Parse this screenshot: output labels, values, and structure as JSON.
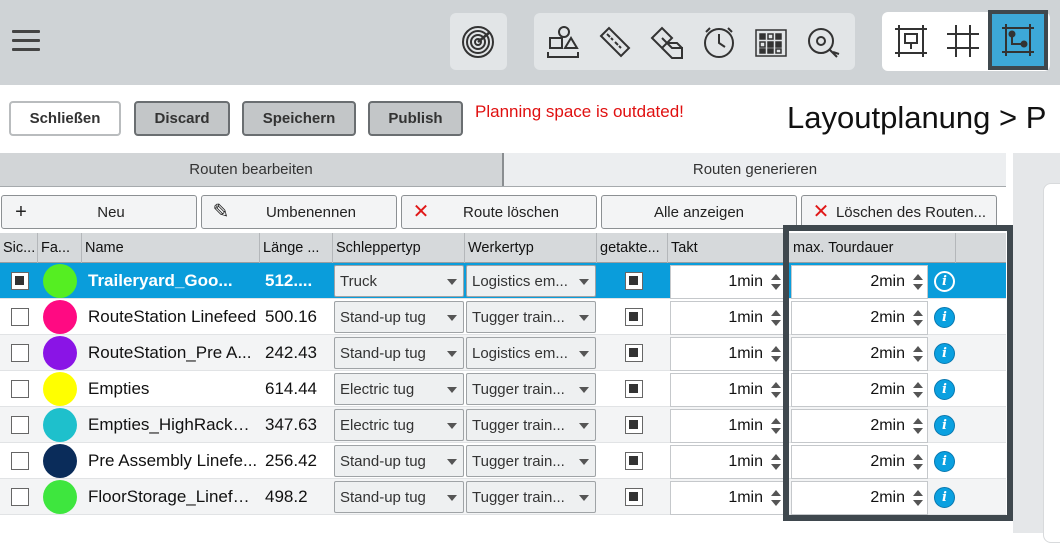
{
  "toolbar": {
    "groups": [
      {
        "icons": [
          "target-rings-icon"
        ]
      },
      {
        "icons": [
          "shapes-icon",
          "ruler-icon",
          "overlap-icon",
          "clock-icon",
          "grid-dots-icon",
          "search-route-icon"
        ]
      },
      {
        "icons": [
          "frame-icon",
          "grid-icon",
          "route-layout-icon"
        ],
        "active_index": 2
      }
    ]
  },
  "actions": {
    "close_label": "Schließen",
    "discard_label": "Discard",
    "save_label": "Speichern",
    "publish_label": "Publish",
    "warning": "Planning space is outdated!",
    "page_title": "Layoutplanung > P"
  },
  "tabs": [
    {
      "label": "Routen bearbeiten"
    },
    {
      "label": "Routen generieren"
    }
  ],
  "route_buttons": {
    "new_label": "Neu",
    "rename_label": "Umbenennen",
    "delete_label": "Route löschen",
    "show_all_label": "Alle anzeigen",
    "delete_routes_label": "Löschen des Routen..."
  },
  "table": {
    "headers": {
      "visible": "Sic...",
      "color": "Fa...",
      "name": "Name",
      "length": "Länge ...",
      "tug_type": "Schleppertyp",
      "worker_type": "Werkertyp",
      "clocked": "getakte...",
      "takt": "Takt",
      "max_tour": "max. Tourdauer"
    },
    "rows": [
      {
        "visible": true,
        "color": "#55ee22",
        "name": "Traileryard_Goo...",
        "length": "512....",
        "tug_type": "Truck",
        "worker_type": "Logistics em...",
        "clocked": true,
        "takt": "1min",
        "max_tour": "2min",
        "selected": true
      },
      {
        "visible": false,
        "color": "#ff0a82",
        "name": "RouteStation Linefeed",
        "length": "500.16",
        "tug_type": "Stand-up tug",
        "worker_type": "Tugger train...",
        "clocked": true,
        "takt": "1min",
        "max_tour": "2min",
        "selected": false
      },
      {
        "visible": false,
        "color": "#8a14e6",
        "name": "RouteStation_Pre A...",
        "length": "242.43",
        "tug_type": "Stand-up tug",
        "worker_type": "Logistics em...",
        "clocked": true,
        "takt": "1min",
        "max_tour": "2min",
        "selected": false
      },
      {
        "visible": false,
        "color": "#ffff00",
        "name": "Empties",
        "length": "614.44",
        "tug_type": "Electric tug",
        "worker_type": "Tugger train...",
        "clocked": true,
        "takt": "1min",
        "max_tour": "2min",
        "selected": false
      },
      {
        "visible": false,
        "color": "#1ec0cc",
        "name": "Empties_HighRackbay",
        "length": "347.63",
        "tug_type": "Electric tug",
        "worker_type": "Tugger train...",
        "clocked": true,
        "takt": "1min",
        "max_tour": "2min",
        "selected": false
      },
      {
        "visible": false,
        "color": "#0a2c5a",
        "name": "Pre Assembly Linefe...",
        "length": "256.42",
        "tug_type": "Stand-up tug",
        "worker_type": "Tugger train...",
        "clocked": true,
        "takt": "1min",
        "max_tour": "2min",
        "selected": false
      },
      {
        "visible": false,
        "color": "#3ee63e",
        "name": "FloorStorage_Linefeed",
        "length": "498.2",
        "tug_type": "Stand-up tug",
        "worker_type": "Tugger train...",
        "clocked": true,
        "takt": "1min",
        "max_tour": "2min",
        "selected": false
      }
    ]
  }
}
